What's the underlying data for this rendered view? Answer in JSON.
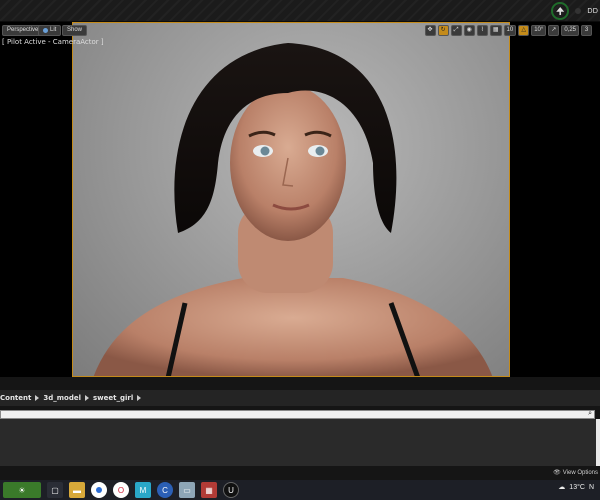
{
  "toolbar": {
    "perspective_label": "Perspective",
    "lit_label": "Lit",
    "show_label": "Show",
    "grid_snap_value": "10",
    "rotation_snap_value": "10°",
    "scale_snap_value": "0,25",
    "camera_speed_value": "3"
  },
  "viewport": {
    "pilot_label": "[ Pilot Active - CameraActor ]"
  },
  "breadcrumb": {
    "items": [
      "Content",
      "3d_model",
      "sweet_girl"
    ]
  },
  "content_browser": {
    "view_options_label": "View Options"
  },
  "top_tray": {
    "text": "DD"
  },
  "taskbar": {
    "weather_temp": "13°C",
    "weather_extra": "N"
  },
  "icons": [
    "search-icon",
    "eye-icon",
    "chrome-icon",
    "opera-icon",
    "folder-icon",
    "unreal-icon"
  ]
}
